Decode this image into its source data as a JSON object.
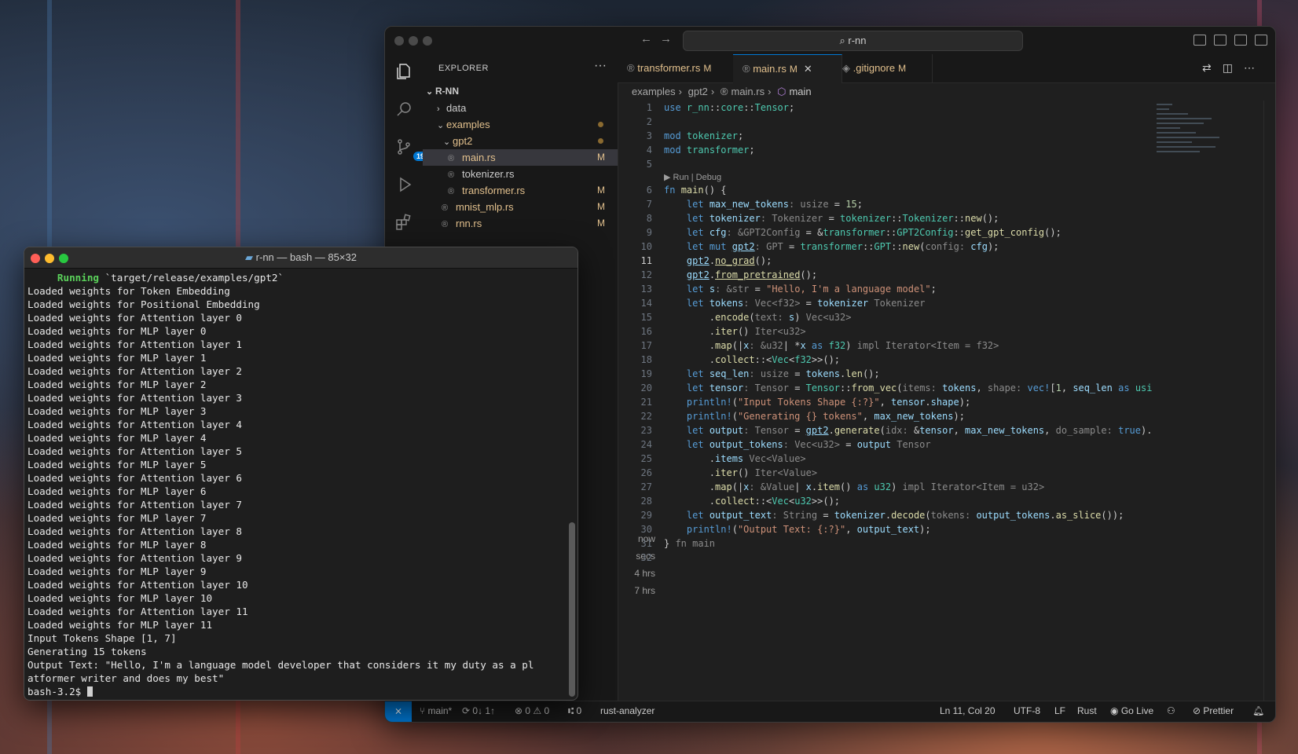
{
  "vscode": {
    "search": "r-nn",
    "explorer": {
      "title": "EXPLORER",
      "more": "···",
      "root": "R-NN",
      "items": [
        {
          "label": "data",
          "status": ""
        },
        {
          "label": "examples",
          "status": "dot"
        },
        {
          "label": "gpt2",
          "status": "dot"
        },
        {
          "label": "main.rs",
          "status": "M"
        },
        {
          "label": "tokenizer.rs",
          "status": ""
        },
        {
          "label": "transformer.rs",
          "status": "M"
        },
        {
          "label": "mnist_mlp.rs",
          "status": "M"
        },
        {
          "label": "rnn.rs",
          "status": "M"
        }
      ],
      "source_control_badge": "19"
    },
    "tabs": [
      {
        "label": "transformer.rs",
        "status": "M"
      },
      {
        "label": "main.rs",
        "status": "M",
        "close": "✕"
      },
      {
        "label": ".gitignore",
        "status": "M"
      }
    ],
    "breadcrumb": [
      "examples",
      "gpt2",
      "main.rs",
      "main"
    ],
    "codelens": "▶ Run | Debug",
    "timeline": [
      "now",
      "secs",
      "4 hrs",
      "7 hrs"
    ],
    "statusbar": {
      "branch": "main*",
      "sync": "0↓ 1↑",
      "problems": "⊗ 0 ⚠ 0",
      "ports": "⑆ 0",
      "analyzer": "rust-analyzer",
      "position": "Ln 11, Col 20",
      "encoding": "UTF-8",
      "eol": "LF",
      "language": "Rust",
      "golive": "Go Live",
      "prettier": "Prettier"
    },
    "current_line": 11
  },
  "terminal": {
    "title": "r-nn — bash — 85×32",
    "running_word": "Running",
    "running_rest": " `target/release/examples/gpt2`",
    "lines": [
      "Loaded weights for Token Embedding",
      "Loaded weights for Positional Embedding",
      "Loaded weights for Attention layer 0",
      "Loaded weights for MLP layer 0",
      "Loaded weights for Attention layer 1",
      "Loaded weights for MLP layer 1",
      "Loaded weights for Attention layer 2",
      "Loaded weights for MLP layer 2",
      "Loaded weights for Attention layer 3",
      "Loaded weights for MLP layer 3",
      "Loaded weights for Attention layer 4",
      "Loaded weights for MLP layer 4",
      "Loaded weights for Attention layer 5",
      "Loaded weights for MLP layer 5",
      "Loaded weights for Attention layer 6",
      "Loaded weights for MLP layer 6",
      "Loaded weights for Attention layer 7",
      "Loaded weights for MLP layer 7",
      "Loaded weights for Attention layer 8",
      "Loaded weights for MLP layer 8",
      "Loaded weights for Attention layer 9",
      "Loaded weights for MLP layer 9",
      "Loaded weights for Attention layer 10",
      "Loaded weights for MLP layer 10",
      "Loaded weights for Attention layer 11",
      "Loaded weights for MLP layer 11",
      "Input Tokens Shape [1, 7]",
      "Generating 15 tokens",
      "Output Text: \"Hello, I'm a language model developer that considers it my duty as a pl",
      "atformer writer and does my best\""
    ],
    "prompt": "bash-3.2$ "
  }
}
